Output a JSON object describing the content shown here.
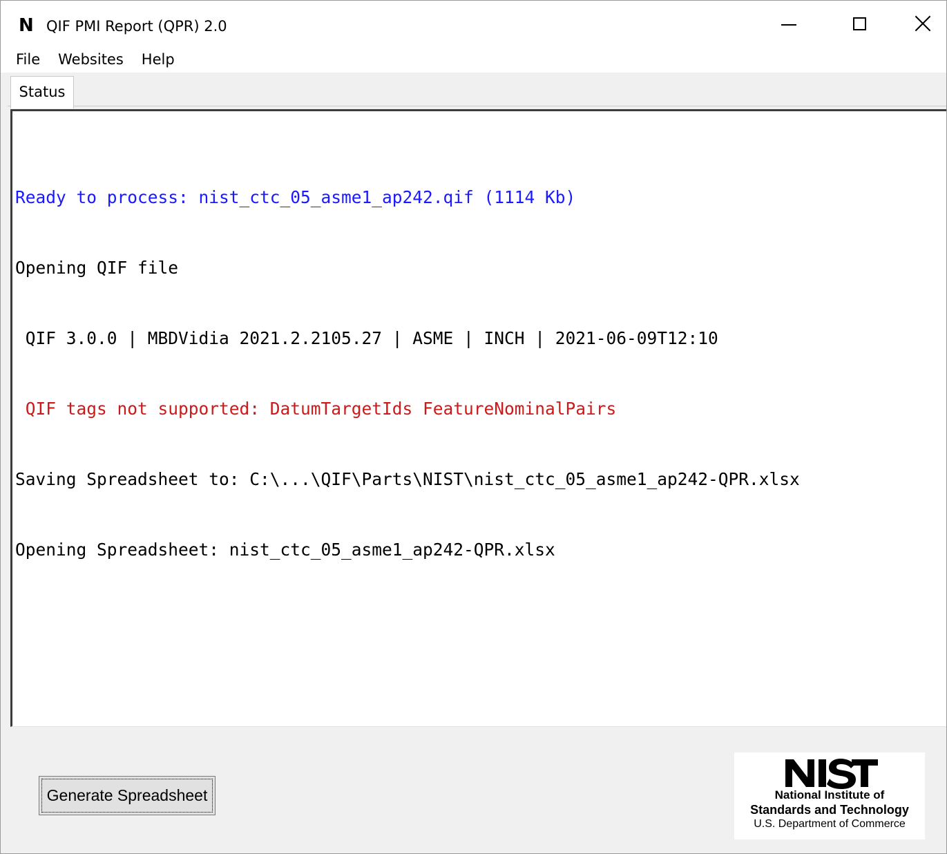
{
  "window": {
    "app_logo_letter": "N",
    "title": "QIF PMI Report (QPR) 2.0"
  },
  "menu": [
    {
      "label": "File"
    },
    {
      "label": "Websites"
    },
    {
      "label": "Help"
    }
  ],
  "tabs": [
    {
      "label": "Status",
      "selected": true
    }
  ],
  "status": {
    "lines": [
      {
        "text": "Ready to process: nist_ctc_05_asme1_ap242.qif (1114 Kb)",
        "color": "#1a1aff"
      },
      {
        "text": "Opening QIF file",
        "color": "#000000"
      },
      {
        "text": " QIF 3.0.0 | MBDVidia 2021.2.2105.27 | ASME | INCH | 2021-06-09T12:10",
        "color": "#000000"
      },
      {
        "text": " QIF tags not supported: DatumTargetIds FeatureNominalPairs",
        "color": "#cc1a1a"
      },
      {
        "text": "Saving Spreadsheet to: C:\\...\\QIF\\Parts\\NIST\\nist_ctc_05_asme1_ap242-QPR.xlsx",
        "color": "#000000"
      },
      {
        "text": "Opening Spreadsheet: nist_ctc_05_asme1_ap242-QPR.xlsx",
        "color": "#000000"
      }
    ]
  },
  "actions": {
    "generate_label": "Generate Spreadsheet"
  },
  "nist_logo": {
    "mark": "NIST",
    "line1": "National Institute of",
    "line2": "Standards and Technology",
    "line3": "U.S. Department of Commerce"
  }
}
